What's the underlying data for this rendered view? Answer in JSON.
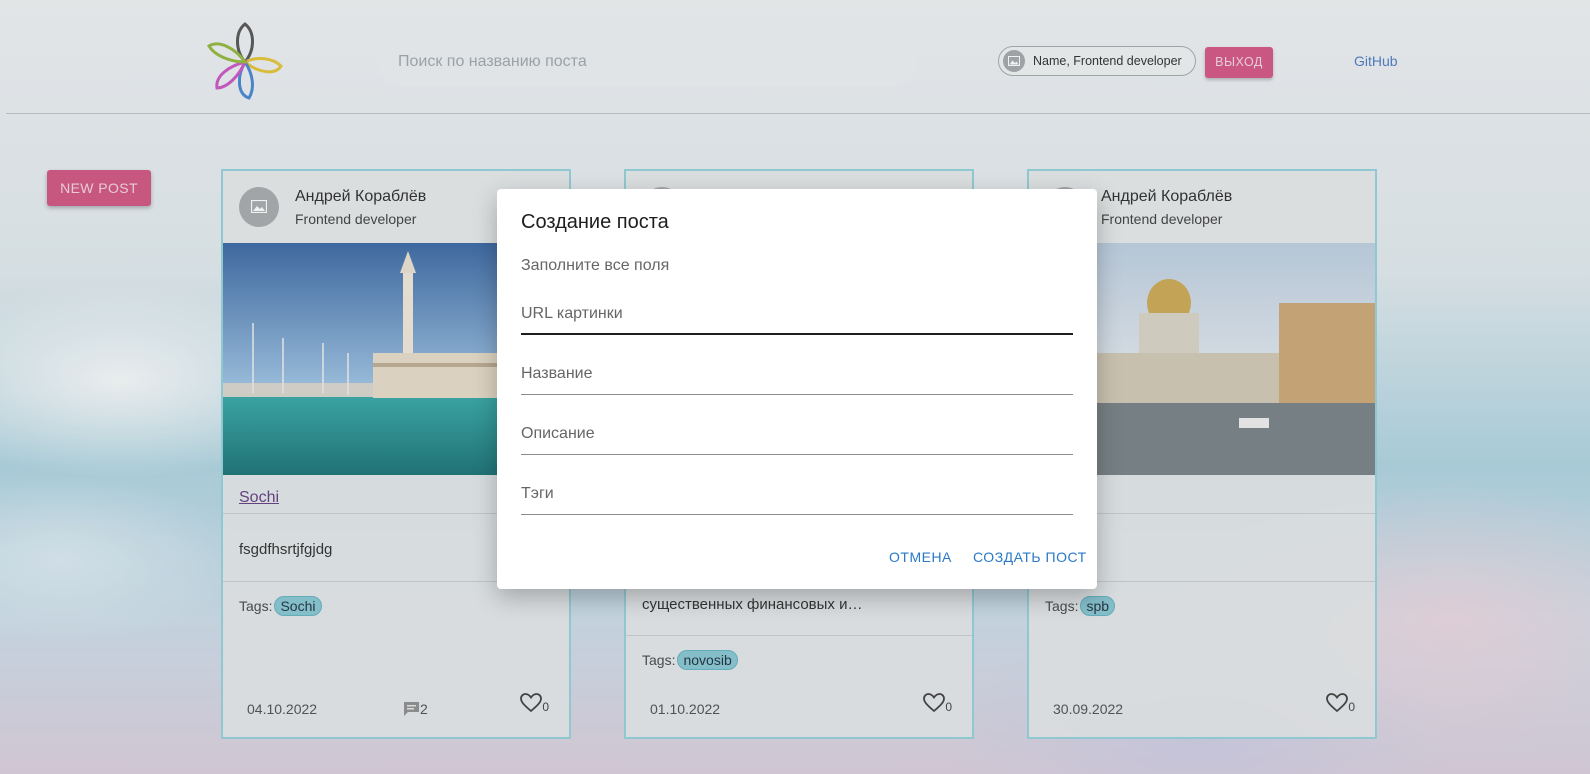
{
  "header": {
    "search_placeholder": "Поиск по названию поста",
    "user_label": "Name, Frontend developer",
    "logout_label": "ВЫХОД",
    "github_label": "GitHub"
  },
  "sidebar": {
    "new_post_label": "NEW POST"
  },
  "posts": [
    {
      "author": "Андрей Кораблёв",
      "role": "Frontend developer",
      "title": "Sochi",
      "text": "fsgdfhsrtjfgjdg",
      "tags_label": "Tags:",
      "tag": "Sochi",
      "date": "04.10.2022",
      "comments": "2",
      "likes": "0"
    },
    {
      "text": "существенных финансовых и…",
      "tags_label": "Tags:",
      "tag": "novosib",
      "date": "01.10.2022",
      "likes": "0"
    },
    {
      "author": "Андрей Кораблёв",
      "role": "Frontend developer",
      "tags_label": "Tags:",
      "tag": "spb",
      "date": "30.09.2022",
      "likes": "0"
    }
  ],
  "modal": {
    "title": "Создание поста",
    "subtitle": "Заполните все поля",
    "fields": [
      {
        "label": "URL картинки",
        "value": ""
      },
      {
        "label": "Название",
        "value": ""
      },
      {
        "label": "Описание",
        "value": ""
      },
      {
        "label": "Тэги",
        "value": ""
      }
    ],
    "cancel_label": "ОТМЕНА",
    "submit_label": "СОЗДАТЬ ПОСТ"
  },
  "colors": {
    "accent_pink": "#d04a7d",
    "link_blue": "#2979c8",
    "card_border": "#8ecfda",
    "tag_bg": "#7fc4d1"
  }
}
